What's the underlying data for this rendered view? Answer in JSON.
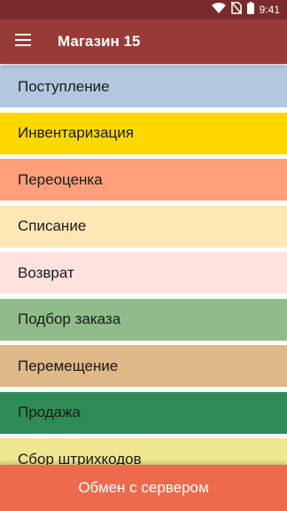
{
  "status_bar": {
    "time": "9:41",
    "icons": [
      "wifi-icon",
      "no-sim-icon",
      "battery-icon"
    ],
    "color": "#7a2a2a"
  },
  "app_bar": {
    "title": "Магазин 15",
    "menu_icon": "hamburger-menu-icon",
    "color": "#983a36"
  },
  "menu": {
    "items": [
      {
        "label": "Поступление",
        "color": "#b3c7df"
      },
      {
        "label": "Инвентаризация",
        "color": "#ffd800"
      },
      {
        "label": "Переоценка",
        "color": "#ffa07a"
      },
      {
        "label": "Списание",
        "color": "#ffe6b4"
      },
      {
        "label": "Возврат",
        "color": "#ffe1dd"
      },
      {
        "label": "Подбор заказа",
        "color": "#8fbc8a"
      },
      {
        "label": "Перемещение",
        "color": "#deb887"
      },
      {
        "label": "Продажа",
        "color": "#2e8b57"
      },
      {
        "label": "Сбор штрихкодов",
        "color": "#efe68f"
      }
    ]
  },
  "footer": {
    "exchange_label": "Обмен с сервером",
    "color": "#ee6a4c"
  }
}
